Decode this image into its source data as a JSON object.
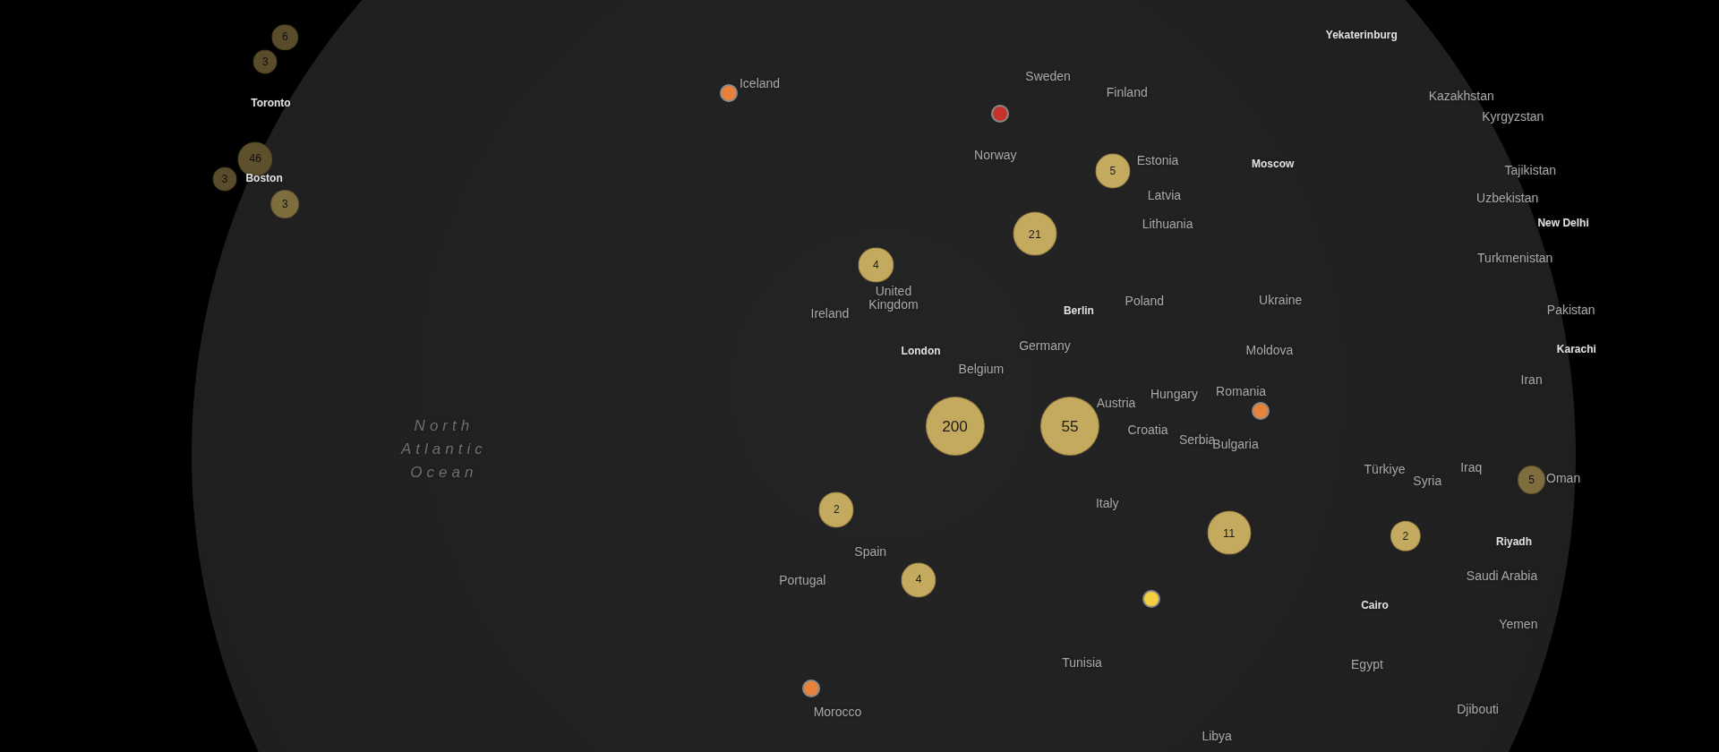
{
  "map": {
    "labels": [
      {
        "text": "Yekaterinburg",
        "kind": "city"
      },
      {
        "text": "Kazakhstan",
        "kind": "country"
      },
      {
        "text": "Kyrgyzstan",
        "kind": "country"
      },
      {
        "text": "Tajikistan",
        "kind": "country"
      },
      {
        "text": "Uzbekistan",
        "kind": "country"
      },
      {
        "text": "New Delhi",
        "kind": "city"
      },
      {
        "text": "Turkmenistan",
        "kind": "country"
      },
      {
        "text": "Pakistan",
        "kind": "country"
      },
      {
        "text": "Karachi",
        "kind": "city"
      },
      {
        "text": "Iran",
        "kind": "country"
      },
      {
        "text": "Iraq",
        "kind": "country"
      },
      {
        "text": "Syria",
        "kind": "country"
      },
      {
        "text": "Oman",
        "kind": "country"
      },
      {
        "text": "Türkiye",
        "kind": "country"
      },
      {
        "text": "Riyadh",
        "kind": "city"
      },
      {
        "text": "Saudi Arabia",
        "kind": "country"
      },
      {
        "text": "Yemen",
        "kind": "country"
      },
      {
        "text": "Cairo",
        "kind": "city"
      },
      {
        "text": "Egypt",
        "kind": "country"
      },
      {
        "text": "Djibouti",
        "kind": "country"
      },
      {
        "text": "Libya",
        "kind": "country"
      },
      {
        "text": "Tunisia",
        "kind": "country"
      },
      {
        "text": "Italy",
        "kind": "country"
      },
      {
        "text": "Morocco",
        "kind": "country"
      },
      {
        "text": "Spain",
        "kind": "country"
      },
      {
        "text": "Portugal",
        "kind": "country"
      },
      {
        "text": "Ireland",
        "kind": "country"
      },
      {
        "text": "United Kingdom",
        "kind": "country"
      },
      {
        "text": "London",
        "kind": "city"
      },
      {
        "text": "Belgium",
        "kind": "country"
      },
      {
        "text": "Germany",
        "kind": "country"
      },
      {
        "text": "Berlin",
        "kind": "city"
      },
      {
        "text": "Poland",
        "kind": "country"
      },
      {
        "text": "Ukraine",
        "kind": "country"
      },
      {
        "text": "Moldova",
        "kind": "country"
      },
      {
        "text": "Romania",
        "kind": "country"
      },
      {
        "text": "Hungary",
        "kind": "country"
      },
      {
        "text": "Austria",
        "kind": "country"
      },
      {
        "text": "Croatia",
        "kind": "country"
      },
      {
        "text": "Serbia",
        "kind": "country"
      },
      {
        "text": "Bulgaria",
        "kind": "country"
      },
      {
        "text": "Sweden",
        "kind": "country"
      },
      {
        "text": "Finland",
        "kind": "country"
      },
      {
        "text": "Norway",
        "kind": "country"
      },
      {
        "text": "Estonia",
        "kind": "country"
      },
      {
        "text": "Latvia",
        "kind": "country"
      },
      {
        "text": "Lithuania",
        "kind": "country"
      },
      {
        "text": "Moscow",
        "kind": "city"
      },
      {
        "text": "Iceland",
        "kind": "country"
      },
      {
        "text": "Toronto",
        "kind": "city"
      },
      {
        "text": "Boston",
        "kind": "city"
      },
      {
        "text": "North Atlantic Ocean",
        "kind": "ocean"
      }
    ],
    "clusters": [
      {
        "count": "6"
      },
      {
        "count": "3"
      },
      {
        "count": "46"
      },
      {
        "count": "3"
      },
      {
        "count": "3"
      },
      {
        "count": "4"
      },
      {
        "count": "21"
      },
      {
        "count": "5"
      },
      {
        "count": "200"
      },
      {
        "count": "55"
      },
      {
        "count": "2"
      },
      {
        "count": "4"
      },
      {
        "count": "11"
      },
      {
        "count": "2"
      },
      {
        "count": "5"
      }
    ],
    "markers": [
      {
        "color": "#e8823a"
      },
      {
        "color": "#c2342c"
      },
      {
        "color": "#e8823a"
      },
      {
        "color": "#f2d03e"
      },
      {
        "color": "#e8823a"
      }
    ]
  }
}
